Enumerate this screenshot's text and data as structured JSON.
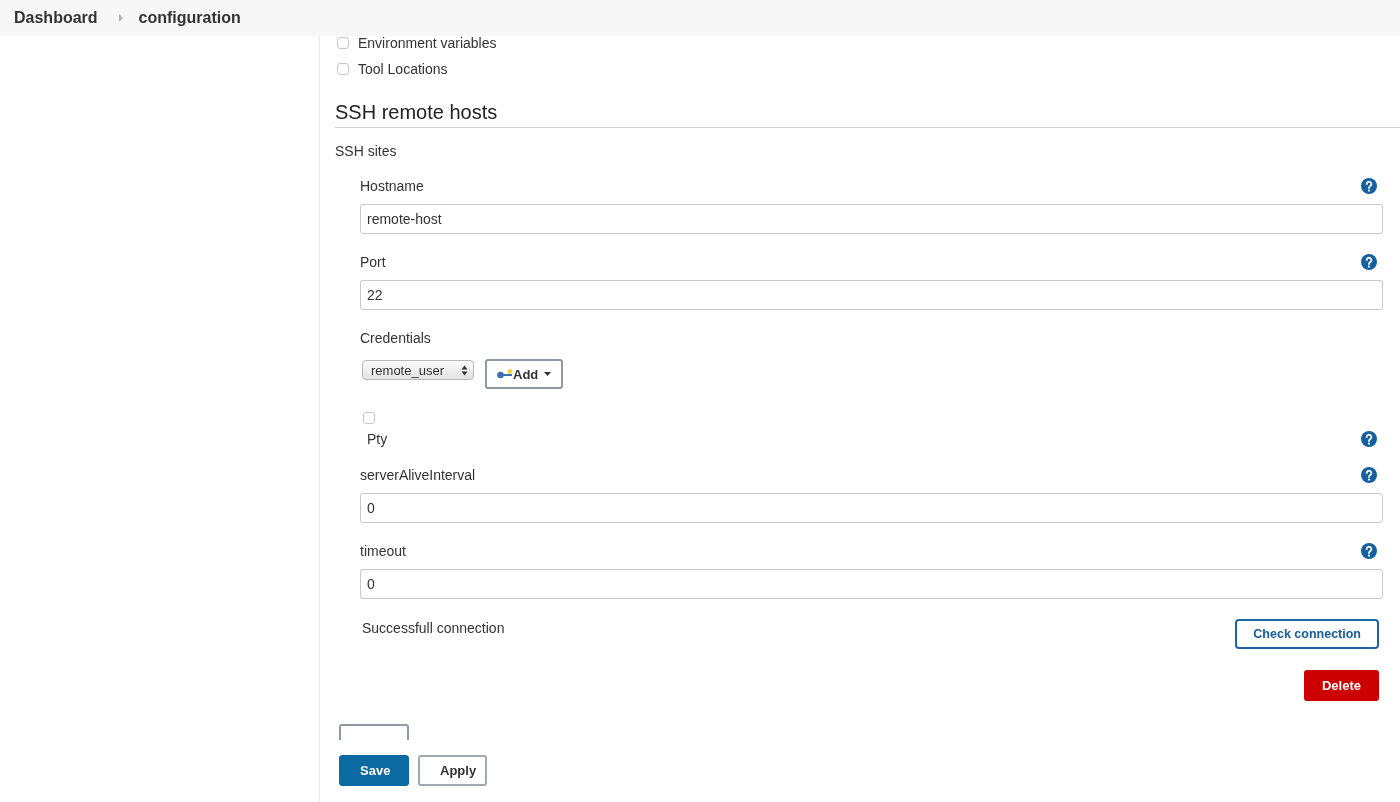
{
  "breadcrumb": [
    {
      "label": "Dashboard"
    },
    {
      "label": "configuration"
    }
  ],
  "options": [
    {
      "label": "Environment variables",
      "checked": false
    },
    {
      "label": "Tool Locations",
      "checked": false
    }
  ],
  "section": {
    "title": "SSH remote hosts",
    "subtitle": "SSH sites"
  },
  "site": {
    "fields": [
      {
        "kind": "text",
        "label": "Hostname",
        "value": "remote-host",
        "help": true
      },
      {
        "kind": "text",
        "label": "Port",
        "value": "22",
        "help": true
      },
      {
        "kind": "credentials",
        "label": "Credentials",
        "value": "remote_user",
        "button": "Add",
        "help": false
      },
      {
        "kind": "checkbox",
        "label": "Pty",
        "checked": false,
        "help": true
      },
      {
        "kind": "text",
        "label": "serverAliveInterval",
        "value": "0",
        "help": true
      },
      {
        "kind": "text",
        "label": "timeout",
        "value": "0",
        "help": true
      }
    ],
    "status": "Successfull connection",
    "check_button": "Check connection",
    "delete_button": "Delete"
  },
  "buttons": [
    {
      "label": "Save",
      "kind": "primary"
    },
    {
      "label": "Apply",
      "kind": "secondary"
    }
  ]
}
